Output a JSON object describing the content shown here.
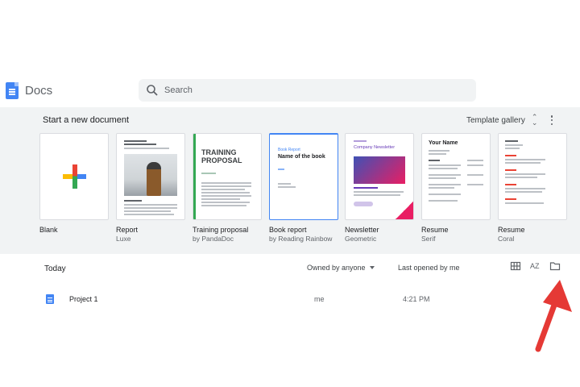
{
  "app": {
    "title": "Docs"
  },
  "search": {
    "placeholder": "Search"
  },
  "templates": {
    "heading": "Start a new document",
    "gallery_label": "Template gallery",
    "items": [
      {
        "name": "Blank",
        "sub": ""
      },
      {
        "name": "Report",
        "sub": "Luxe"
      },
      {
        "name": "Training proposal",
        "sub": "by PandaDoc"
      },
      {
        "name": "Book report",
        "sub": "by Reading Rainbow"
      },
      {
        "name": "Newsletter",
        "sub": "Geometric"
      },
      {
        "name": "Resume",
        "sub": "Serif"
      },
      {
        "name": "Resume",
        "sub": "Coral"
      }
    ],
    "thumb_text": {
      "training": "TRAINING\nPROPOSAL",
      "book_sub": "Book Report",
      "book_title": "Name of the book",
      "newsletter_title": "Company Newsletter",
      "resume_serif_title": "Your Name"
    }
  },
  "recent": {
    "group_label": "Today",
    "owner_filter": "Owned by anyone",
    "sort_label": "Last opened by me",
    "documents": [
      {
        "name": "Project 1",
        "owner": "me",
        "time": "4:21 PM"
      }
    ]
  },
  "icons": {
    "sort_az": "AZ"
  },
  "colors": {
    "brand_blue": "#4285f4",
    "annotation_arrow": "#e53935",
    "template_bg": "#f1f3f4"
  }
}
